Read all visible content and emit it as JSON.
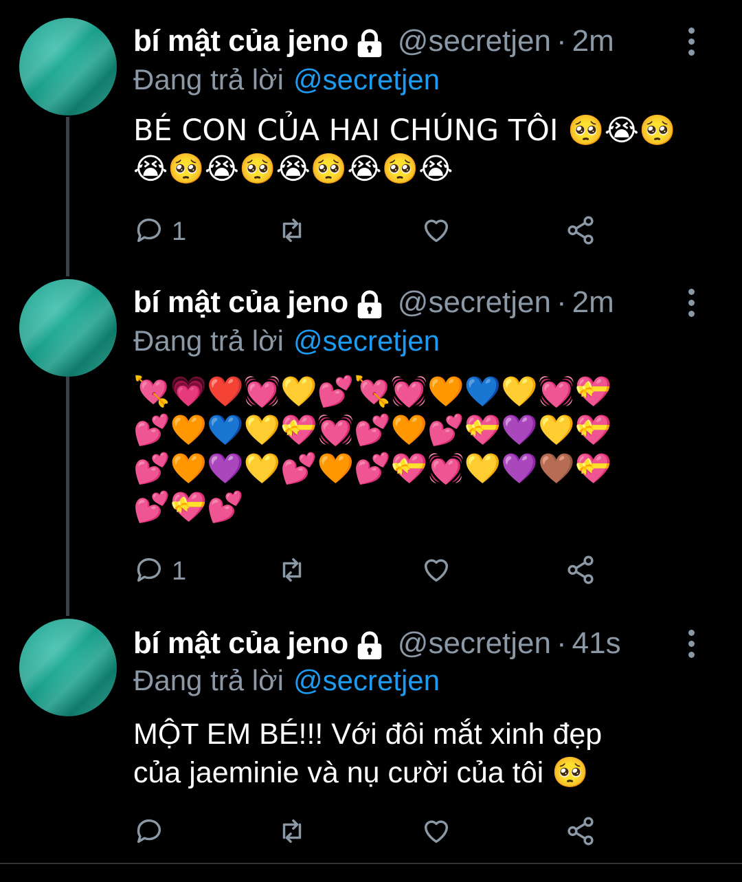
{
  "tweets": [
    {
      "name": "bí mật của jeno",
      "handle": "@secretjen",
      "separator": "·",
      "time": "2m",
      "reply_label": "Đang trả lời",
      "reply_handle": "@secretjen",
      "text_line1": "BÉ CON CỦA HAI CHÚNG TÔI 🥺😭🥺",
      "text_line2": "😭🥺😭🥺😭🥺😭🥺😭",
      "reply_count": "1"
    },
    {
      "name": "bí mật của jeno",
      "handle": "@secretjen",
      "separator": "·",
      "time": "2m",
      "reply_label": "Đang trả lời",
      "reply_handle": "@secretjen",
      "text_line1": "💘💗❤️💓💛💕💘💓🧡💙💛💓💝",
      "text_line2": "💕🧡💙💛💝💓💕🧡💕💝💜💛💝",
      "text_line3": "💕🧡💜💛💕🧡💕💝💓💛💜🤎💝",
      "text_line4": "💕💝💕",
      "reply_count": "1"
    },
    {
      "name": "bí mật của jeno",
      "handle": "@secretjen",
      "separator": "·",
      "time": "41s",
      "reply_label": "Đang trả lời",
      "reply_handle": "@secretjen",
      "text_line1": "MỘT EM BÉ!!! Với đôi mắt xinh đẹp",
      "text_line2": "của jaeminie và nụ cười của tôi 🥺",
      "reply_count": ""
    }
  ],
  "icons": {
    "lock": "lock-icon",
    "reply": "reply-icon",
    "retweet": "retweet-icon",
    "like": "heart-icon",
    "share": "share-icon",
    "more": "more-vertical-icon"
  },
  "colors": {
    "background": "#000000",
    "secondary_text": "#8b98a5",
    "link": "#1d9bf0",
    "avatar": "#169a86"
  }
}
